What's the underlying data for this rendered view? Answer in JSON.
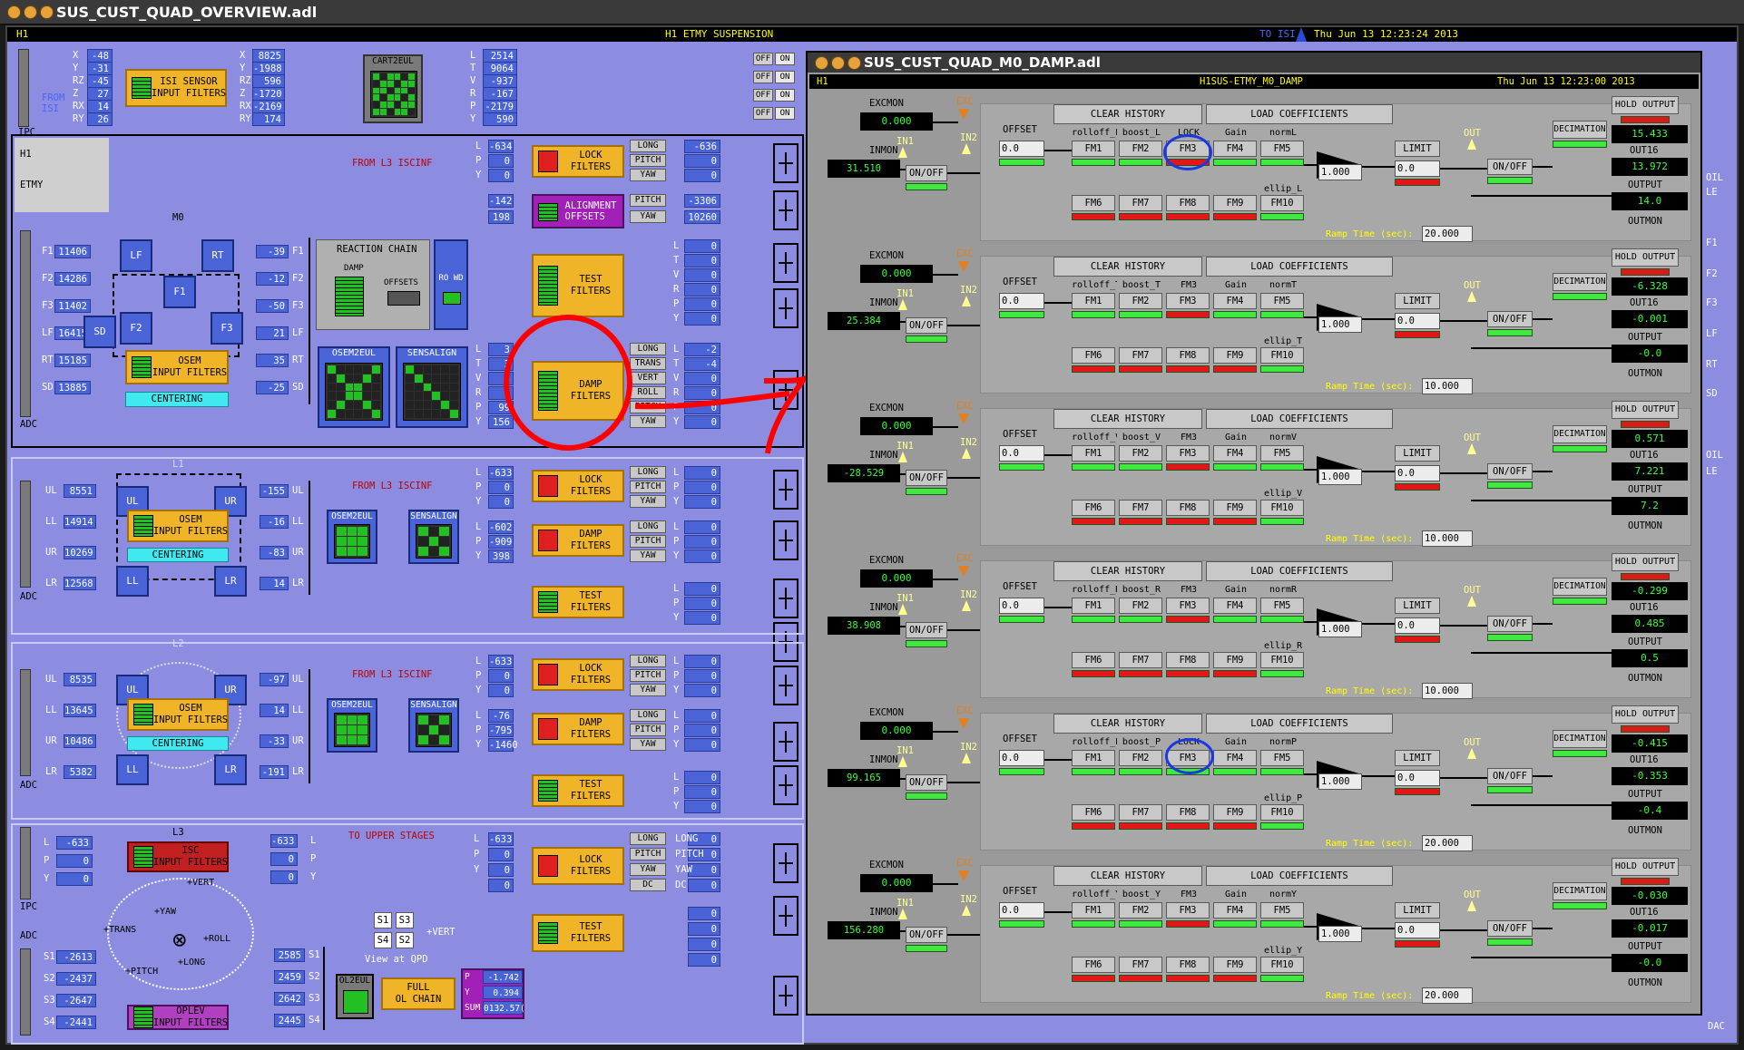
{
  "main": {
    "title": "SUS_CUST_QUAD_OVERVIEW.adl",
    "site": "H1",
    "header": "H1 ETMY SUSPENSION",
    "to_isi": "TO ISI",
    "timestamp": "Thu Jun 13 12:23:24 2013"
  },
  "isi": {
    "ipc": "IPC",
    "from_isi": "FROM\nISI",
    "in_labels": [
      "X",
      "Y",
      "RZ",
      "Z",
      "RX",
      "RY"
    ],
    "in_values": [
      "-48",
      "-31",
      "-45",
      "27",
      "14",
      "26"
    ],
    "sensor_filter": "ISI SENSOR\nINPUT FILTERS",
    "out_values": [
      "8825",
      "-1988",
      "596",
      "-1720",
      "-2169",
      "174"
    ],
    "cart2eul": "CART2EUL",
    "eul_labels": [
      "L",
      "T",
      "V",
      "R",
      "P",
      "Y"
    ],
    "eul_values": [
      "2514",
      "9064",
      "-937",
      "-167",
      "-2179",
      "590"
    ]
  },
  "offon": [
    "OFF",
    "ON",
    "OFF",
    "ON",
    "OFF",
    "ON",
    "OFF",
    "ON"
  ],
  "m0": {
    "h1": "H1",
    "etmy": "ETMY",
    "stage": "M0",
    "adc": "ADC",
    "osem_labels": [
      "F1",
      "F2",
      "F3",
      "LF",
      "RT",
      "SD"
    ],
    "osem_values": [
      "11406",
      "14286",
      "11402",
      "16415",
      "15185",
      "13885"
    ],
    "osem_blocks": [
      "LF",
      "RT",
      "F1",
      "SD",
      "F2",
      "F3"
    ],
    "osem_filter": "OSEM\nINPUT FILTERS",
    "centering": "CENTERING",
    "out_values": [
      "-39",
      "-12",
      "-50",
      "21",
      "35",
      "-25"
    ],
    "reaction_chain": "REACTION CHAIN",
    "damp_label": "DAMP",
    "offsets_label": "OFFSETS",
    "rowd_label": "RO WD",
    "ltvrpy": "LTVRPY",
    "osem2eul": "OSEM2EUL",
    "sensalign": "SENSALIGN",
    "from_l3": "FROM L3 ISCINF",
    "lock_values": [
      "-634",
      "0",
      "0"
    ],
    "lock_filter": "LOCK\nFILTERS",
    "lock_dofs": [
      "LONG",
      "PITCH",
      "YAW"
    ],
    "lock_out": [
      "-636",
      "0",
      "0"
    ],
    "align_values": [
      "-142",
      "198"
    ],
    "align_filter": "ALIGNMENT\nOFFSETS",
    "align_dofs": [
      "PITCH",
      "YAW"
    ],
    "align_out": [
      "-3306",
      "10260"
    ],
    "test_filter": "TEST\nFILTERS",
    "test_out": [
      "0",
      "0",
      "0",
      "0",
      "0",
      "0"
    ],
    "damp_in": [
      "3",
      "3",
      "3",
      "3",
      "99",
      "156"
    ],
    "damp_filter": "DAMP\nFILTERS",
    "damp_dofs": [
      "LONG",
      "TRANS",
      "VERT",
      "ROLL",
      "PITCH",
      "YAW"
    ],
    "damp_out": [
      "-2",
      "-4",
      "0",
      "0",
      "0",
      "0"
    ]
  },
  "l1": {
    "stage": "L1",
    "adc": "ADC",
    "osem_labels": [
      "UL",
      "LL",
      "UR",
      "LR"
    ],
    "osem_values": [
      "8551",
      "14914",
      "10269",
      "12568"
    ],
    "out_values": [
      "-155",
      "-16",
      "-83",
      "14"
    ],
    "lock_values": [
      "-633",
      "0",
      "0"
    ],
    "damp_values": [
      "-602",
      "-909",
      "398"
    ],
    "lock_out": [
      "0",
      "0",
      "0"
    ],
    "damp_out": [
      "0",
      "0",
      "0"
    ],
    "test_out": [
      "0",
      "0",
      "0"
    ]
  },
  "l2": {
    "stage": "L2",
    "adc": "ADC",
    "osem_values": [
      "8535",
      "13645",
      "10486",
      "5382"
    ],
    "out_values": [
      "-97",
      "14",
      "-33",
      "-191"
    ],
    "lock_values": [
      "-633",
      "0",
      "0"
    ],
    "damp_values": [
      "-76",
      "-795",
      "-1460"
    ],
    "lock_out": [
      "0",
      "0",
      "0"
    ],
    "damp_out": [
      "0",
      "0",
      "0"
    ],
    "test_out": [
      "0",
      "0",
      "0"
    ]
  },
  "l3": {
    "stage": "L3",
    "ipc": "IPC",
    "adc": "ADC",
    "isc_labels": [
      "L",
      "P",
      "Y"
    ],
    "isc_values": [
      "-633",
      "0",
      "0"
    ],
    "isc_filter": "ISC\nINPUT FILTERS",
    "mid_values": [
      "-633",
      "0",
      "0"
    ],
    "to_upper": "TO UPPER STAGES",
    "lock_values": [
      "-633",
      "0",
      "0",
      "0"
    ],
    "lock_dofs": [
      "LONG",
      "PITCH",
      "YAW",
      "DC"
    ],
    "lock_out": [
      "0",
      "0",
      "0",
      "0"
    ],
    "test_out": [
      "0",
      "0",
      "0",
      "0"
    ],
    "dirs": [
      "+YAW",
      "+VERT",
      "+TRANS",
      "+ROLL",
      "+PITCH",
      "+LONG"
    ],
    "oplev_labels": [
      "S1",
      "S2",
      "S3",
      "S4"
    ],
    "oplev_values": [
      "-2613",
      "-2437",
      "-2647",
      "-2441"
    ],
    "oplev_filter": "OPLEV\nINPUT FILTERS",
    "qpd_values": [
      "2585",
      "2459",
      "2642",
      "2445"
    ],
    "qpd_quads": [
      "S1",
      "S3",
      "S4",
      "S2"
    ],
    "qpd_vert": "+VERT",
    "qpd_view": "View at QPD",
    "ol2eul": "OL2EUL",
    "full_ol": "FULL\nOL CHAIN",
    "ol_labels": [
      "P",
      "Y",
      "SUM"
    ],
    "ol_values": [
      "-1.742",
      "0.394",
      "0132.57("
    ]
  },
  "right_edge": [
    "OIL",
    "LE",
    "F1",
    "F2",
    "F3",
    "LF",
    "RT",
    "SD",
    "OIL",
    "LE",
    "DAC"
  ],
  "damp": {
    "title": "SUS_CUST_QUAD_M0_DAMP.adl",
    "site": "H1",
    "header": "H1SUS-ETMY_M0_DAMP",
    "timestamp": "Thu Jun 13 12:23:00 2013",
    "excmon": "EXCMON",
    "inmon": "INMON",
    "exc": "EXC",
    "in1": "IN1",
    "in2": "IN2",
    "offset": "OFFSET",
    "onoff": "ON/OFF",
    "limit": "LIMIT",
    "out": "OUT",
    "decimation": "DECIMATION",
    "hold_output": "HOLD OUTPUT",
    "out16": "OUT16",
    "output": "OUTPUT",
    "outmon": "OUTMON",
    "clear_history": "CLEAR HISTORY",
    "load_coeff": "LOAD COEFFICIENTS",
    "ramp_time": "Ramp Time (sec):",
    "fm_row1": [
      "FM1",
      "FM2",
      "FM3",
      "FM4",
      "FM5"
    ],
    "fm_row2": [
      "FM6",
      "FM7",
      "FM8",
      "FM9",
      "FM10"
    ],
    "gain_label": "Gain",
    "channels": [
      {
        "dof": "L",
        "excmon": "0.000",
        "inmon": "31.510",
        "offset": "0.0",
        "gain": "1.000",
        "limit": "0.0",
        "names": [
          "rolloff_L",
          "boost_L",
          "LOCK",
          "Gain",
          "normL"
        ],
        "ellip": "ellip_L",
        "ramp": "20.000",
        "out16": "15.433",
        "output": "13.972",
        "outmon": "14.0"
      },
      {
        "dof": "T",
        "excmon": "0.000",
        "inmon": "25.384",
        "offset": "0.0",
        "gain": "1.000",
        "limit": "0.0",
        "names": [
          "rolloff_T",
          "boost_T",
          "FM3",
          "Gain",
          "normT"
        ],
        "ellip": "ellip_T",
        "ramp": "10.000",
        "out16": "-6.328",
        "output": "-0.001",
        "outmon": "-0.0"
      },
      {
        "dof": "V",
        "excmon": "0.000",
        "inmon": "-28.529",
        "offset": "0.0",
        "gain": "1.000",
        "limit": "0.0",
        "names": [
          "rolloff_V",
          "boost_V",
          "FM3",
          "Gain",
          "normV"
        ],
        "ellip": "ellip_V",
        "ramp": "10.000",
        "out16": "0.571",
        "output": "7.221",
        "outmon": "7.2"
      },
      {
        "dof": "R",
        "excmon": "0.000",
        "inmon": "38.908",
        "offset": "0.0",
        "gain": "1.000",
        "limit": "0.0",
        "names": [
          "rolloff_R",
          "boost_R",
          "FM3",
          "Gain",
          "normR"
        ],
        "ellip": "ellip_R",
        "ramp": "10.000",
        "out16": "-0.299",
        "output": "0.485",
        "outmon": "0.5"
      },
      {
        "dof": "P",
        "excmon": "0.000",
        "inmon": "99.165",
        "offset": "0.0",
        "gain": "1.000",
        "limit": "0.0",
        "names": [
          "rolloff_P",
          "boost_P",
          "LOCK",
          "Gain",
          "normP"
        ],
        "ellip": "ellip_P",
        "ramp": "20.000",
        "out16": "-0.415",
        "output": "-0.353",
        "outmon": "-0.4"
      },
      {
        "dof": "Y",
        "excmon": "0.000",
        "inmon": "156.280",
        "offset": "0.0",
        "gain": "1.000",
        "limit": "0.0",
        "names": [
          "rolloff_Y",
          "boost_Y",
          "FM3",
          "Gain",
          "normY"
        ],
        "ellip": "ellip_Y",
        "ramp": "20.000",
        "out16": "-0.030",
        "output": "-0.017",
        "outmon": "-0.0"
      }
    ]
  },
  "colors": {
    "canvas": "#8c8ce0",
    "numeric": "#4a64d8",
    "filter": "#f0b428",
    "on": "#40e840",
    "off": "#e01818",
    "annotation_red": "#ff0000",
    "annotation_blue": "#1a3ae0"
  }
}
